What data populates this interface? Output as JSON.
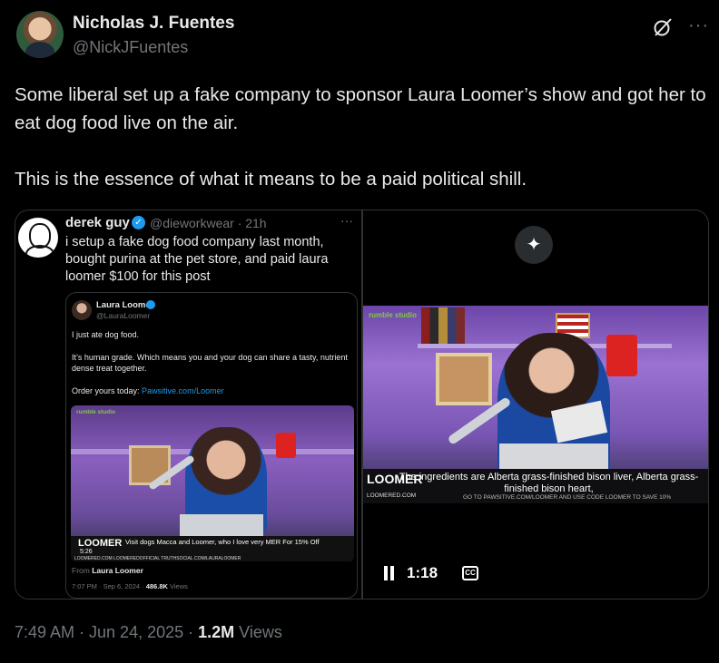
{
  "author": {
    "display_name": "Nicholas J. Fuentes",
    "handle": "@NickJFuentes"
  },
  "header_icons": {
    "grok": "grok-icon",
    "more": "···"
  },
  "tweet": {
    "line1": "Some liberal set up a fake company to sponsor Laura Loomer’s show and got her to eat dog food live on the air.",
    "line2": "This is the essence of what it means to be a paid political shill."
  },
  "quoted": {
    "name": "derek guy",
    "verified": "✓",
    "meta": "@dieworkwear · 21h",
    "dots": "···",
    "text": "i setup a fake dog food company last month, bought purina at the pet store, and paid laura loomer $100 for this post",
    "inner": {
      "name": "Laura Loomer",
      "handle": "@LauraLoomer",
      "p1": "I just ate dog food.",
      "p2": "It’s human grade. Which means you and your dog can share a tasty, nutrient dense treat together.",
      "p3_prefix": "Order yours today: ",
      "p3_link": "Pawsitive.com/Loomer",
      "video": {
        "rumble": "rumble studio",
        "loomer": "LOOMER",
        "time": "5:26",
        "caption": "Visit dogs Macca and Loomer, who I love very MER For 15% Off",
        "url": "LOOMERED.COM   LOOMEREDOFFICIAL   TRUTHSOCIAL.COM/LAURALOOMER"
      },
      "from_prefix": "From ",
      "from_name": "Laura Loomer",
      "footer_prefix": "7:07 PM · Sep 6, 2024 · ",
      "footer_views": "486.8K",
      "footer_suffix": " Views"
    }
  },
  "video": {
    "sparkle": "✦",
    "rumble": "rumble studio",
    "loomer": "LOOMER",
    "caption": "The ingredients are Alberta grass-finished bison liver, Alberta grass-finished bison heart,",
    "url": "LOOMERED.COM",
    "ticker": "GO TO PAWSITIVE.COM/LOOMER AND USE CODE LOOMER TO SAVE 10%",
    "time": "1:18",
    "cc": "CC"
  },
  "footer": {
    "timestamp": "7:49 AM · Jun 24, 2025 · ",
    "views_count": "1.2M",
    "views_label": " Views"
  }
}
